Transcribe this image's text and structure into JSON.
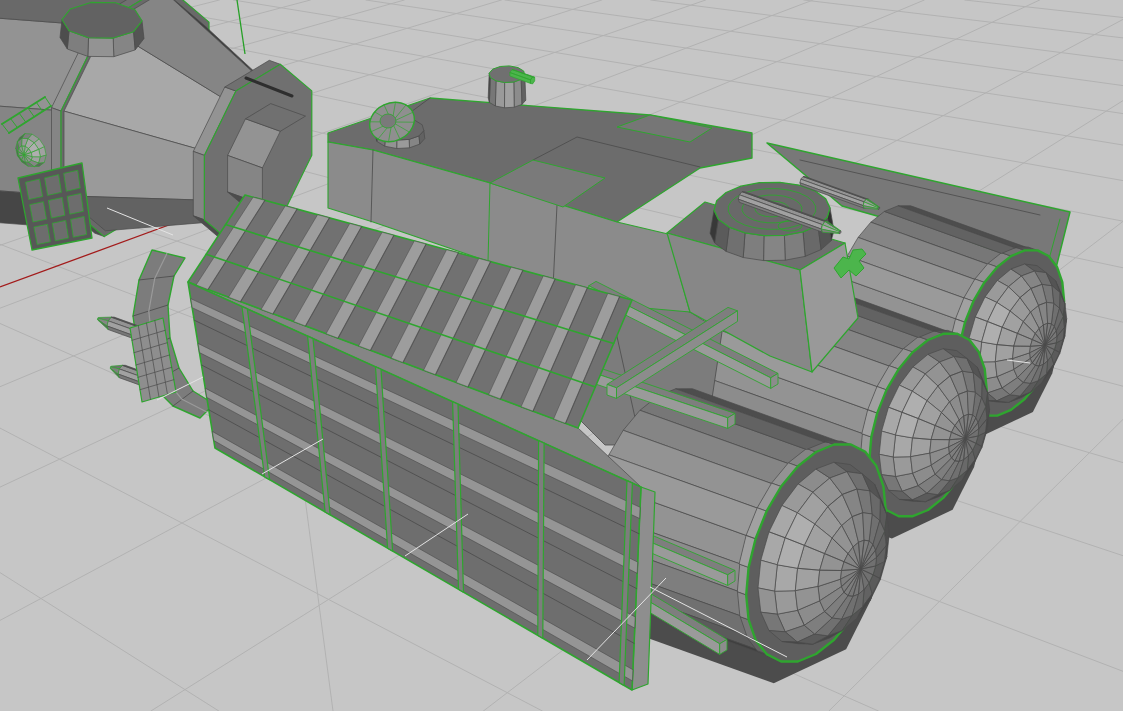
{
  "viewport": {
    "show_grid": true,
    "show_axes": true
  },
  "model": {
    "selected": true
  }
}
